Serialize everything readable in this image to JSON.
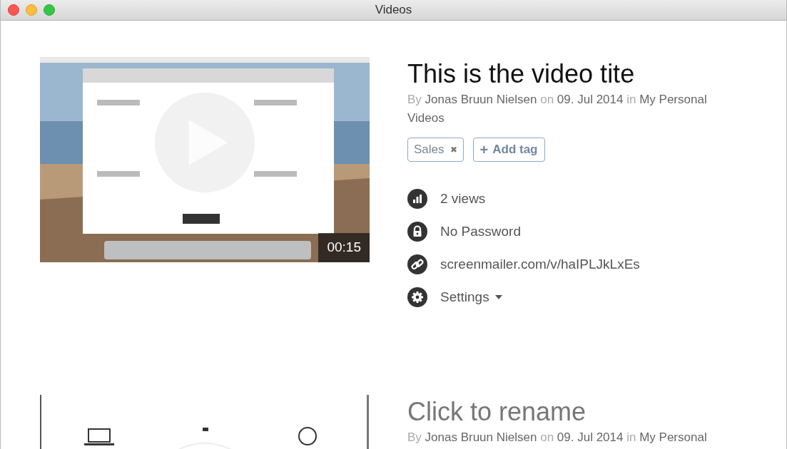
{
  "window": {
    "title": "Videos"
  },
  "videos": [
    {
      "thumbnail": {
        "kind": "picture",
        "duration": "00:15",
        "play_button": true
      },
      "title": "This is the video tite",
      "untitled": false,
      "meta": {
        "by": "By",
        "author": "Jonas Bruun Nielsen",
        "on": "on",
        "date": "09. Jul 2014",
        "in": "in",
        "folder": "My Personal Videos"
      },
      "tags": [
        {
          "label": "Sales",
          "remove": "✖"
        }
      ],
      "add_tag": {
        "icon": "+",
        "label": "Add tag"
      },
      "details": [
        {
          "kind": "views",
          "text": "2 views"
        },
        {
          "kind": "password",
          "text": "No Password"
        },
        {
          "kind": "link",
          "text": "screenmailer.com/v/haIPLJkLxEs"
        },
        {
          "kind": "settings",
          "text": "Settings",
          "dropdown": true
        }
      ]
    },
    {
      "title": "Click to rename",
      "untitled": true,
      "meta": {
        "by": "By",
        "author": "Jonas Bruun Nielsen",
        "on": "on",
        "date": "09. Jul 2014",
        "in": "in",
        "folder": "My Personal"
      }
    }
  ]
}
